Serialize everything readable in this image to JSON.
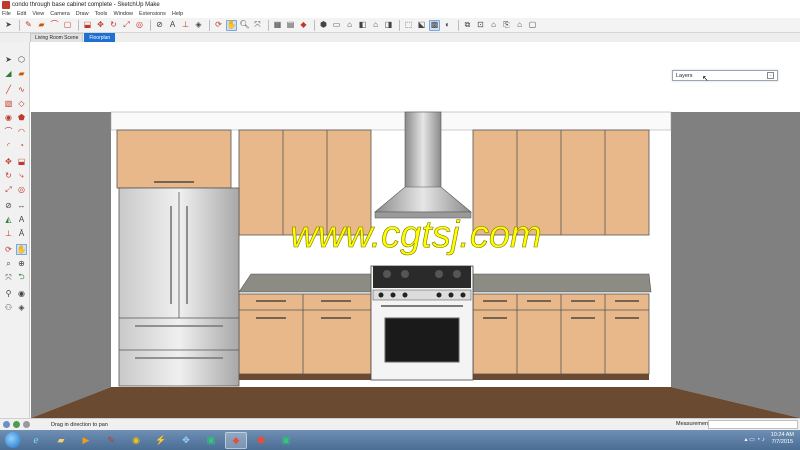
{
  "window": {
    "title": "condo through base cabinet complete - SketchUp Make"
  },
  "menu": [
    "File",
    "Edit",
    "View",
    "Camera",
    "Draw",
    "Tools",
    "Window",
    "Extensions",
    "Help"
  ],
  "scenes": [
    {
      "label": "Living Room Scene",
      "active": false
    },
    {
      "label": "Floorplan",
      "active": true
    }
  ],
  "layers_panel": {
    "title": "Layers"
  },
  "watermark": "www.cgtsj.com",
  "status": {
    "message": "Drag in direction to pan",
    "measurements_label": "Measurements",
    "measurements_value": ""
  },
  "taskbar": {
    "time": "10:24 AM",
    "date": "7/7/2015"
  },
  "colors": {
    "wood": "#e8b88a",
    "wall": "#808080",
    "floor": "#6b4a32",
    "countertop": "#8c8c84",
    "watermark": "#ffff00",
    "accent": "#1f6fd0"
  }
}
